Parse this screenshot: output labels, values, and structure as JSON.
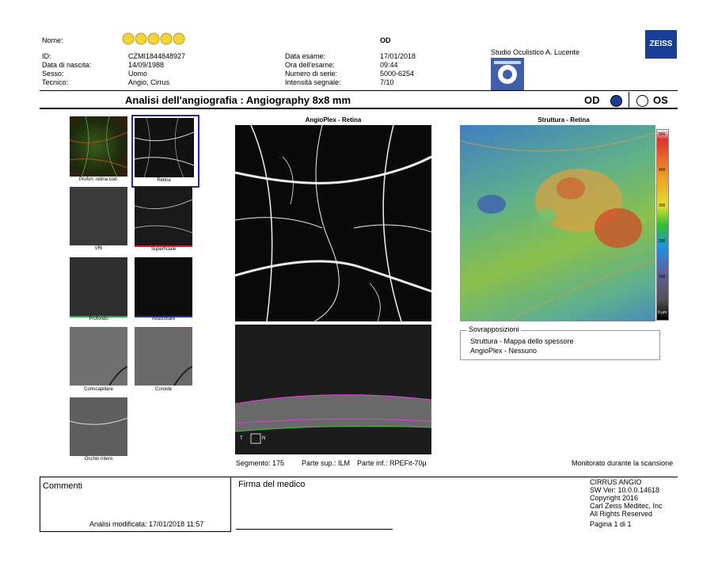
{
  "patient": {
    "name_label": "Nome:",
    "id_label": "ID:",
    "id": "CZMI1844848927",
    "dob_label": "Data di nascita:",
    "dob": "14/09/1988",
    "sex_label": "Sesso:",
    "sex": "Uomo",
    "tech_label": "Tecnico:",
    "tech": "Angio, Cirrus"
  },
  "exam": {
    "eye": "OD",
    "date_label": "Data esame:",
    "date": "17/01/2018",
    "time_label": "Ora dell'esame:",
    "time": "09:44",
    "serial_label": "Numero di serie:",
    "serial": "5000-6254",
    "signal_label": "Intensità segnale:",
    "signal": "7/10"
  },
  "clinic": {
    "name": "Studio Oculistico A. Lucente"
  },
  "brand": {
    "logo_text": "ZEISS"
  },
  "report": {
    "title": "Analisi dell'angiografia : Angiography 8x8 mm",
    "od_label": "OD",
    "os_label": "OS"
  },
  "thumbnails": [
    {
      "label": "Profon. retina cod."
    },
    {
      "label": "Retina"
    },
    {
      "label": "VRI"
    },
    {
      "label": "Superficiale"
    },
    {
      "label": "Profondo"
    },
    {
      "label": "Avascolare"
    },
    {
      "label": "Coriocapillare"
    },
    {
      "label": "Coroide"
    },
    {
      "label": "Occhio intero"
    }
  ],
  "panels": {
    "angio_title": "AngioPlex - Retina",
    "struct_title": "Struttura - Retina",
    "scale_ticks": [
      "500",
      "400",
      "300",
      "200",
      "100",
      "0 µm"
    ],
    "bscan_t": "T",
    "bscan_n": "N"
  },
  "overlays": {
    "legend": "Sovrapposizioni",
    "line1": "Struttura - Mappa dello spessore",
    "line2": "AngioPlex - Nessuno"
  },
  "segment": {
    "seg": "Segmento: 175",
    "upper": "Parte sup.: ILM",
    "lower": "Parte inf.: RPEFit-70µ",
    "monitor": "Monitorato durante la scansione"
  },
  "footer": {
    "comments_label": "Commenti",
    "analysis_modified": "Analisi modificata: 17/01/2018 11:57",
    "signature_label": "Firma del medico",
    "sw1": "CIRRUS ANGIO",
    "sw2": "SW Ver: 10.0.0.14618",
    "sw3": "Copyright 2016",
    "sw4": "Carl Zeiss Meditec, Inc",
    "sw5": "All Rights Reserved",
    "page": "Pagina 1 di 1"
  }
}
